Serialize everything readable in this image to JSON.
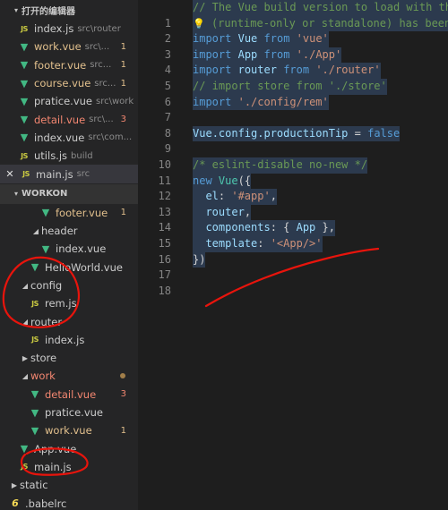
{
  "sidebar": {
    "open_editors_title": "打开的编辑器",
    "open_editors": [
      {
        "icon": "js",
        "name": "index.js",
        "path": "src\\router",
        "badge": "",
        "status": ""
      },
      {
        "icon": "vue",
        "name": "work.vue",
        "path": "src\\...",
        "badge": "1",
        "status": "mod"
      },
      {
        "icon": "vue",
        "name": "footer.vue",
        "path": "src...",
        "badge": "1",
        "status": "mod"
      },
      {
        "icon": "vue",
        "name": "course.vue",
        "path": "src...",
        "badge": "1",
        "status": "mod"
      },
      {
        "icon": "vue",
        "name": "pratice.vue",
        "path": "src\\work",
        "badge": "",
        "status": ""
      },
      {
        "icon": "vue",
        "name": "detail.vue",
        "path": "src\\...",
        "badge": "3",
        "status": "err"
      },
      {
        "icon": "vue",
        "name": "index.vue",
        "path": "src\\com...",
        "badge": "",
        "status": ""
      },
      {
        "icon": "js",
        "name": "utils.js",
        "path": "build",
        "badge": "",
        "status": ""
      },
      {
        "icon": "js",
        "name": "main.js",
        "path": "src",
        "badge": "",
        "status": ""
      }
    ],
    "workspace_title": "WORKON",
    "tree": {
      "footer": "footer.vue",
      "footer_badge": "1",
      "header": "header",
      "index_vue": "index.vue",
      "helloworld": "HelloWorld.vue",
      "config": "config",
      "rem": "rem.js",
      "router": "router",
      "index_js": "index.js",
      "store": "store",
      "work": "work",
      "detail": "detail.vue",
      "detail_badge": "3",
      "pratice": "pratice.vue",
      "workvue": "work.vue",
      "workvue_badge": "1",
      "app": "App.vue",
      "main": "main.js",
      "static": "static",
      "babelrc": ".babelrc"
    }
  },
  "editor": {
    "line_numbers": [
      "1",
      "2",
      "3",
      "4",
      "5",
      "6",
      "7",
      "8",
      "9",
      "10",
      "11",
      "12",
      "13",
      "14",
      "15",
      "16",
      "17",
      "18"
    ],
    "line1": "// The Vue build version to load with th",
    "line2": "(runtime-only or standalone) has been",
    "l3_import": "import",
    "l3_name": "Vue",
    "l3_from": "from",
    "l3_str": "'vue'",
    "l4_import": "import",
    "l4_name": "App",
    "l4_from": "from",
    "l4_str": "'./App'",
    "l5_import": "import",
    "l5_name": "router",
    "l5_from": "from",
    "l5_str": "'./router'",
    "line6": "// import store from './store'",
    "l7_import": "import",
    "l7_str": "'./config/rem'",
    "l9_obj": "Vue",
    "l9_prop": ".config.productionTip",
    "l9_eq": " = ",
    "l9_val": "false",
    "line11": "/* eslint-disable no-new */",
    "l12_new": "new",
    "l12_cls": "Vue",
    "l12_open": "({",
    "l13_key": "el",
    "l13_colon": ": ",
    "l13_str": "'#app'",
    "l13_comma": ",",
    "l14_key": "router",
    "l14_comma": ",",
    "l15_key": "components",
    "l15_open": ": { ",
    "l15_cls": "App",
    "l15_close": " },",
    "l16_key": "template",
    "l16_colon": ": ",
    "l16_str": "'<App/>'",
    "l17": "})"
  },
  "colors": {
    "annotation_red": "#e8140c",
    "vue_icon": "#42b883",
    "js_icon": "#cbcb41",
    "modified": "#e2c08d",
    "error": "#f48771"
  }
}
